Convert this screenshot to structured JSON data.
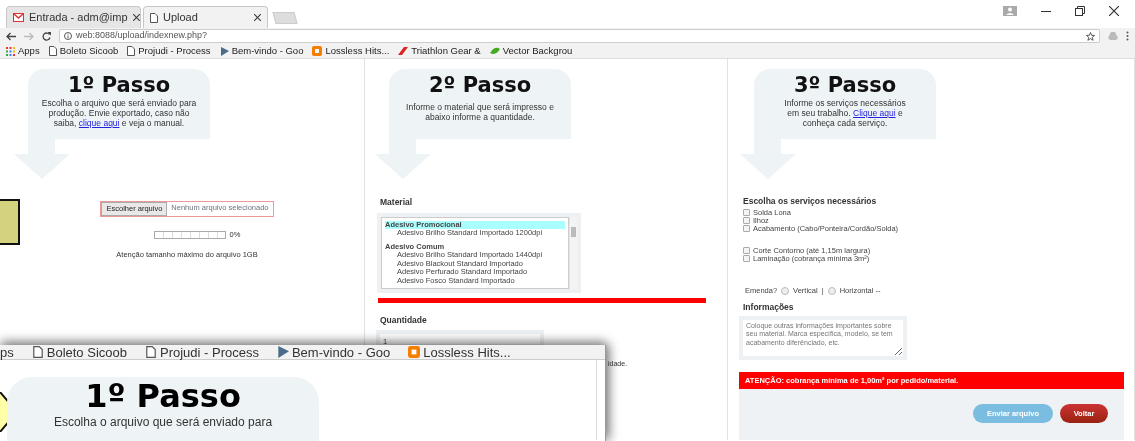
{
  "browser": {
    "tabs": [
      {
        "title": "Entrada - adm@imp",
        "kind": "mail",
        "selected": false
      },
      {
        "title": "Upload",
        "kind": "page",
        "selected": true
      }
    ],
    "url": "web:8088/upload/indexnew.php?",
    "bookmarks": [
      {
        "title": "Apps",
        "kind": "apps"
      },
      {
        "title": "Boleto Sicoob",
        "kind": "page"
      },
      {
        "title": "Projudi - Process",
        "kind": "page"
      },
      {
        "title": "Bem-vindo - Goo",
        "kind": "flag"
      },
      {
        "title": "Lossless Hits...",
        "kind": "blog"
      },
      {
        "title": "Triathlon Gear &",
        "kind": "wing"
      },
      {
        "title": "Vector Backgrou",
        "kind": "leaf"
      }
    ]
  },
  "step1": {
    "heading": "1º Passo",
    "text_before": "Escolha o arquivo que será enviado para produção. Envie exportado, caso não saiba, ",
    "link": "clique aqui",
    "text_after": " e veja o manual.",
    "file_button": "Escolher arquivo",
    "file_status": "Nenhum arquivo selecionado",
    "progress": {
      "level": 0,
      "reading": "0%"
    },
    "note": "Atenção tamanho máximo do arquivo 1GB"
  },
  "step2": {
    "heading": "2º Passo",
    "text": "Informe o material que será impresso e abaixo informe a quantidade.",
    "material_label": "Material",
    "materials": [
      {
        "label": "Adesivo Promocional",
        "kind": "group",
        "selected": true
      },
      {
        "label": "Adesivo Brilho Standard Importado 1200dpi",
        "kind": "option",
        "selected": false
      },
      {
        "label": "Adesivo Comum",
        "kind": "group",
        "selected": false
      },
      {
        "label": "Adesivo Brilho Standard Importado 1440dpi",
        "kind": "option",
        "selected": false
      },
      {
        "label": "Adesivo Blackout Standard Importado",
        "kind": "option",
        "selected": false
      },
      {
        "label": "Adesivo Perfurado Standard Importado",
        "kind": "option",
        "selected": false
      },
      {
        "label": "Adesivo Fosco Standard Importado",
        "kind": "option",
        "selected": false
      }
    ],
    "quantity_label": "Quantidade",
    "quantity": "1",
    "quantity_note": "idade."
  },
  "step3": {
    "heading": "3º Passo",
    "text_before": "Informe os serviços necessários em seu trabalho. ",
    "link": "Clique aqui",
    "text_after": " e conheça cada serviço.",
    "services_label": "Escolha os serviços necessários",
    "service_groups": [
      {
        "items": [
          {
            "label": "Solda Lona",
            "checked": false
          },
          {
            "label": "Ilhoz",
            "checked": false
          },
          {
            "label": "Acabamento (Cabo/Ponteira/Cordão/Solda)",
            "checked": false
          }
        ]
      },
      {
        "items": [
          {
            "label": "Corte Contorno (até 1,15m largura)",
            "checked": false
          },
          {
            "label": "Laminação (cobrança mínima 3m²)",
            "checked": false
          }
        ]
      }
    ],
    "splice": {
      "label": "Emenda?",
      "separator": "|",
      "options": [
        {
          "label": "Vertical",
          "selected": false
        },
        {
          "label": "Horizontal --",
          "selected": false
        }
      ]
    },
    "info_label": "Informações",
    "info_placeholder": "Coloque outras informações importantes sobre seu material. Marca específica, modelo, se tem acabamento diferênciado, etc.",
    "alert": "ATENÇÃO: cobrança mínima de 1,00m² por pedido/material.",
    "buttons": [
      {
        "label": "Enviar arquivo",
        "kind": "send",
        "disabled": true
      },
      {
        "label": "Voltar",
        "kind": "back",
        "disabled": false
      }
    ]
  },
  "zoom_inset": {
    "bookmarks": [
      {
        "title": "ps",
        "kind": "none"
      },
      {
        "title": "Boleto Sicoob",
        "kind": "page"
      },
      {
        "title": "Projudi - Process",
        "kind": "page"
      },
      {
        "title": "Bem-vindo - Goo",
        "kind": "flag"
      },
      {
        "title": "Lossless Hits...",
        "kind": "blog"
      }
    ],
    "heading": "1º Passo",
    "text": "Escolha o arquivo que será enviado para"
  }
}
